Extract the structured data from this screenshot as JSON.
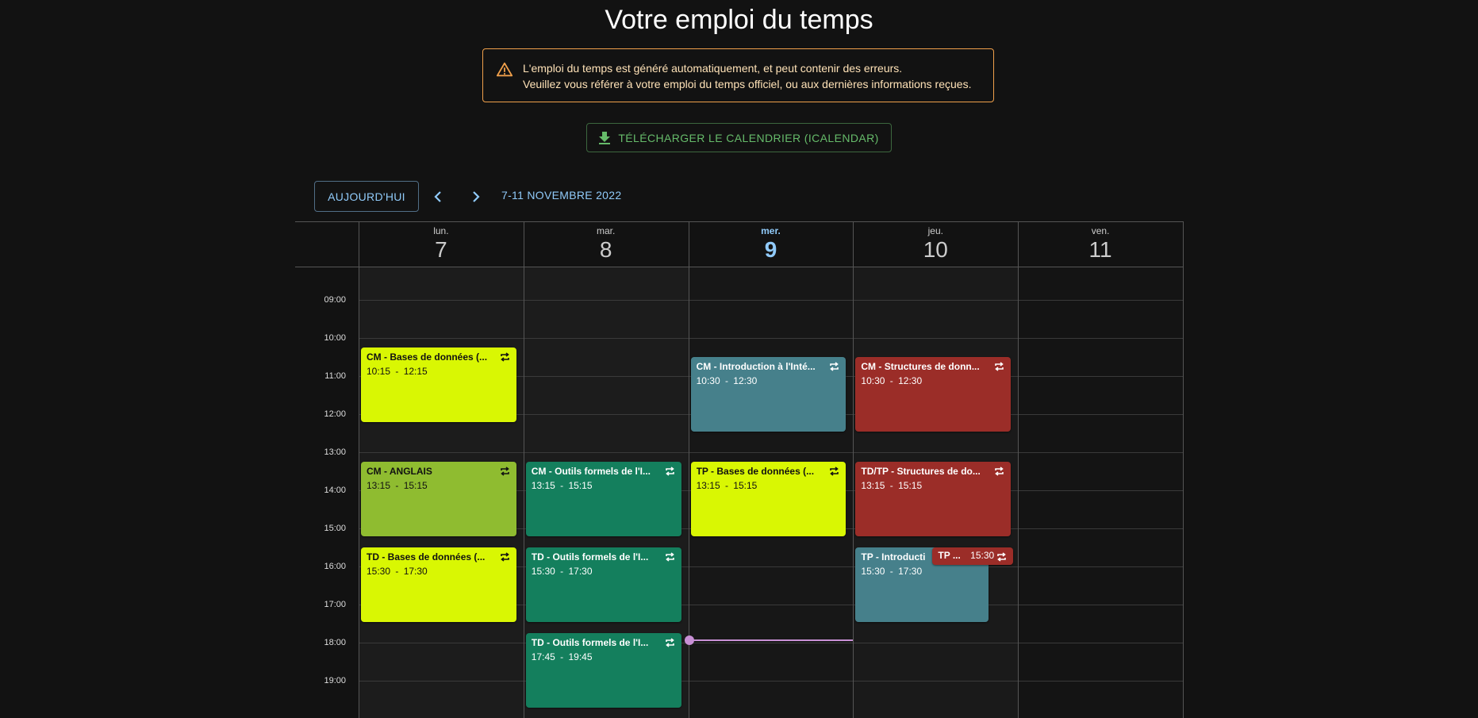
{
  "page": {
    "title": "Votre emploi du temps"
  },
  "alert": {
    "icon": "warning-icon",
    "line1": "L'emploi du temps est généré automatiquement, et peut contenir des erreurs.",
    "line2": "Veuillez vous référer à votre emploi du temps officiel, ou aux dernières informations reçues."
  },
  "download": {
    "icon": "download-icon",
    "label": "TÉLÉCHARGER LE CALENDRIER (ICALENDAR)"
  },
  "toolbar": {
    "today_label": "AUJOURD'HUI",
    "prev_icon": "chevron-left-icon",
    "next_icon": "chevron-right-icon",
    "range_label": "7-11 NOVEMBRE 2022"
  },
  "days": [
    {
      "name": "lun.",
      "date": "7",
      "today": false
    },
    {
      "name": "mar.",
      "date": "8",
      "today": false
    },
    {
      "name": "mer.",
      "date": "9",
      "today": true
    },
    {
      "name": "jeu.",
      "date": "10",
      "today": false
    },
    {
      "name": "ven.",
      "date": "11",
      "today": false
    }
  ],
  "hours": [
    "09:00",
    "10:00",
    "11:00",
    "12:00",
    "13:00",
    "14:00",
    "15:00",
    "16:00",
    "17:00",
    "18:00",
    "19:00"
  ],
  "now_time": "17:55",
  "colors": {
    "yellow": "#d9f703",
    "olive": "#8fbc30",
    "green": "#147f5d",
    "teal": "#46808b",
    "red": "#9b2d28",
    "now": "#c990d6"
  },
  "events": [
    {
      "day": 0,
      "title": "CM - Bases de données (...",
      "start": "10:15",
      "end": "12:15",
      "color": "yellow",
      "text": "dark"
    },
    {
      "day": 0,
      "title": "CM - ANGLAIS",
      "start": "13:15",
      "end": "15:15",
      "color": "olive",
      "text": "dark"
    },
    {
      "day": 0,
      "title": "TD - Bases de données (...",
      "start": "15:30",
      "end": "17:30",
      "color": "yellow",
      "text": "dark"
    },
    {
      "day": 1,
      "title": "CM - Outils formels de l'I...",
      "start": "13:15",
      "end": "15:15",
      "color": "green",
      "text": "light"
    },
    {
      "day": 1,
      "title": "TD - Outils formels de l'I...",
      "start": "15:30",
      "end": "17:30",
      "color": "green",
      "text": "light"
    },
    {
      "day": 1,
      "title": "TD - Outils formels de l'I...",
      "start": "17:45",
      "end": "19:45",
      "color": "green",
      "text": "light"
    },
    {
      "day": 2,
      "title": "CM - Introduction à l'Inté...",
      "start": "10:30",
      "end": "12:30",
      "color": "teal",
      "text": "light"
    },
    {
      "day": 2,
      "title": "TP - Bases de données (...",
      "start": "13:15",
      "end": "15:15",
      "color": "yellow",
      "text": "dark"
    },
    {
      "day": 3,
      "title": "CM - Structures de donn...",
      "start": "10:30",
      "end": "12:30",
      "color": "red",
      "text": "light"
    },
    {
      "day": 3,
      "title": "TD/TP - Structures de do...",
      "start": "13:15",
      "end": "15:15",
      "color": "red",
      "text": "light"
    },
    {
      "day": 3,
      "title": "TP - Introducti",
      "start": "15:30",
      "end": "17:30",
      "color": "teal",
      "text": "light",
      "narrow": true
    },
    {
      "day": 3,
      "title": "TP ...",
      "start": "15:30",
      "end": "",
      "color": "red",
      "text": "light",
      "mini": true
    }
  ]
}
